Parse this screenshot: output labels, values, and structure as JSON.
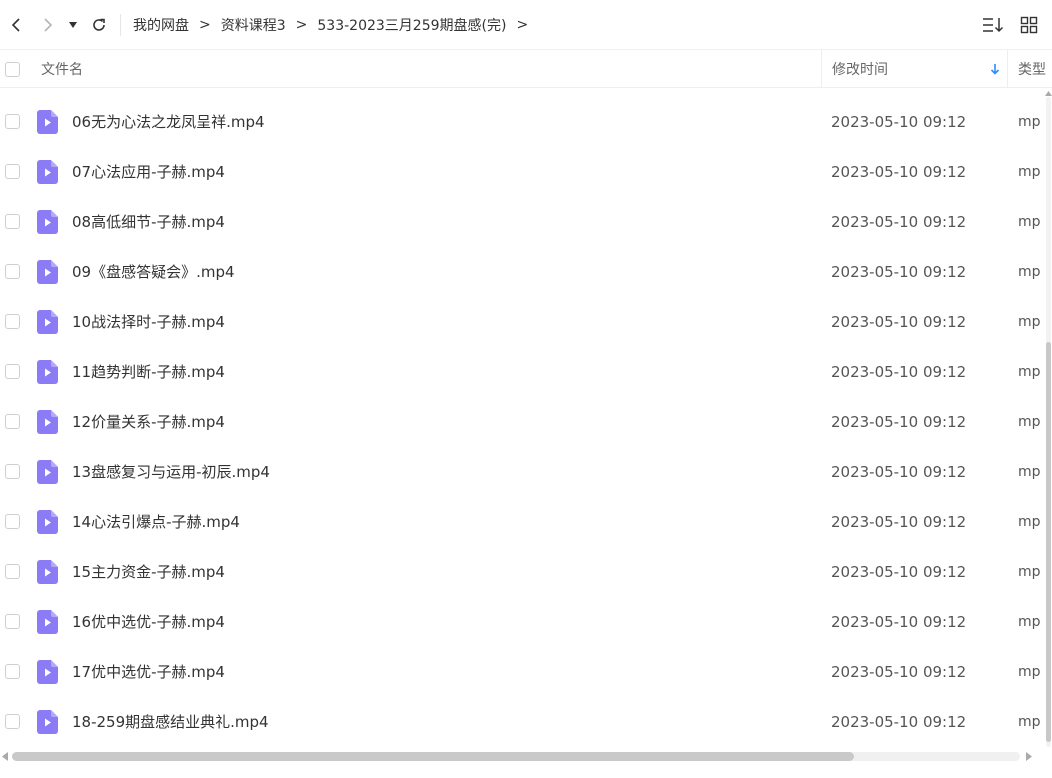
{
  "breadcrumb": [
    "我的网盘",
    "资料课程3",
    "533-2023三月259期盘感(完)"
  ],
  "breadcrumb_separator": ">",
  "columns": {
    "name": "文件名",
    "time": "修改时间",
    "type": "类型"
  },
  "files": [
    {
      "name": "06无为心法之龙凤呈祥.mp4",
      "time": "2023-05-10 09:12",
      "type": "mp"
    },
    {
      "name": "07心法应用-子赫.mp4",
      "time": "2023-05-10 09:12",
      "type": "mp"
    },
    {
      "name": "08高低细节-子赫.mp4",
      "time": "2023-05-10 09:12",
      "type": "mp"
    },
    {
      "name": "09《盘感答疑会》.mp4",
      "time": "2023-05-10 09:12",
      "type": "mp"
    },
    {
      "name": "10战法择时-子赫.mp4",
      "time": "2023-05-10 09:12",
      "type": "mp"
    },
    {
      "name": "11趋势判断-子赫.mp4",
      "time": "2023-05-10 09:12",
      "type": "mp"
    },
    {
      "name": "12价量关系-子赫.mp4",
      "time": "2023-05-10 09:12",
      "type": "mp"
    },
    {
      "name": "13盘感复习与运用-初辰.mp4",
      "time": "2023-05-10 09:12",
      "type": "mp"
    },
    {
      "name": "14心法引爆点-子赫.mp4",
      "time": "2023-05-10 09:12",
      "type": "mp"
    },
    {
      "name": "15主力资金-子赫.mp4",
      "time": "2023-05-10 09:12",
      "type": "mp"
    },
    {
      "name": "16优中选优-子赫.mp4",
      "time": "2023-05-10 09:12",
      "type": "mp"
    },
    {
      "name": "17优中选优-子赫.mp4",
      "time": "2023-05-10 09:12",
      "type": "mp"
    },
    {
      "name": "18-259期盘感结业典礼.mp4",
      "time": "2023-05-10 09:12",
      "type": "mp"
    }
  ],
  "icons": {
    "back": "chevron-left-icon",
    "forward": "chevron-right-icon",
    "dropdown": "caret-down-icon",
    "refresh": "refresh-icon",
    "sort": "sort-list-icon",
    "grid": "grid-view-icon",
    "file": "video-file-icon",
    "sort_direction": "arrow-down-icon"
  },
  "colors": {
    "file_icon": "#8b7cf6",
    "sort_arrow": "#2f8cff"
  }
}
